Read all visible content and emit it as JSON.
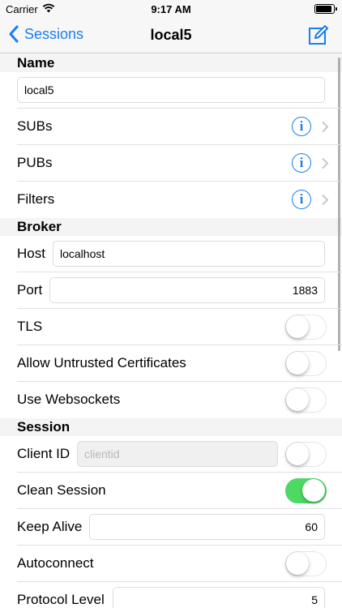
{
  "status_bar": {
    "carrier": "Carrier",
    "time": "9:17 AM"
  },
  "nav": {
    "back_label": "Sessions",
    "title": "local5"
  },
  "sections": {
    "name": {
      "header": "Name",
      "value": "local5"
    },
    "subs": {
      "label": "SUBs"
    },
    "pubs": {
      "label": "PUBs"
    },
    "filters": {
      "label": "Filters"
    },
    "broker": {
      "header": "Broker",
      "host_label": "Host",
      "host_value": "localhost",
      "port_label": "Port",
      "port_value": "1883",
      "tls_label": "TLS",
      "tls_on": false,
      "untrusted_label": "Allow Untrusted Certificates",
      "untrusted_on": false,
      "websockets_label": "Use Websockets",
      "websockets_on": false
    },
    "session": {
      "header": "Session",
      "clientid_label": "Client ID",
      "clientid_placeholder": "clientid",
      "clientid_on": false,
      "clean_label": "Clean Session",
      "clean_on": true,
      "keepalive_label": "Keep Alive",
      "keepalive_value": "60",
      "autoconnect_label": "Autoconnect",
      "autoconnect_on": false,
      "protocol_label": "Protocol Level",
      "protocol_value": "5"
    }
  },
  "icons": {
    "back": "chevron-left-icon",
    "edit": "compose-icon",
    "info": "info-icon",
    "disclosure": "chevron-right-icon"
  },
  "colors": {
    "accent": "#1a7df1",
    "switch_on": "#4cd964"
  }
}
